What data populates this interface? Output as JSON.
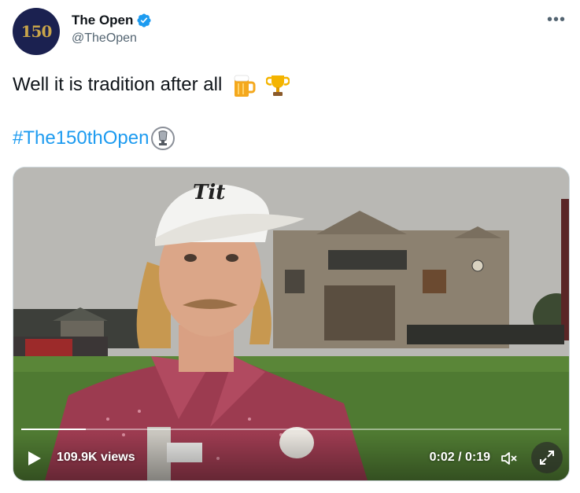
{
  "author": {
    "avatar_text": "150",
    "display_name": "The Open",
    "handle": "@TheOpen",
    "verified": true
  },
  "tweet": {
    "text": "Well it is tradition after all",
    "emojis": [
      "beer-mug-icon",
      "trophy-icon"
    ],
    "hashtag": "#The150thOpen"
  },
  "video": {
    "views": "109.9K views",
    "time": "0:02 / 0:19",
    "progress": 0.12
  },
  "colors": {
    "link": "#1d9bf0",
    "verified": "#1d9bf0",
    "avatar_bg": "#1b2150",
    "avatar_gold": "#c9a54a"
  }
}
